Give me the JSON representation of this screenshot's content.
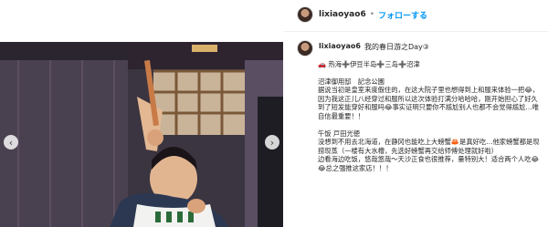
{
  "post": {
    "username": "lixiaoyao6",
    "follow_label": "フォローする",
    "separator": "•",
    "caption_title": "我的春日游之Day③",
    "route": "🚗 热海➕伊豆半岛➕三岛➕沼津",
    "section1_heading": "沼津御用邸　記念公園",
    "section1_body": "据说当初是皇室来度假住的，在这大院子里也想得到上和服来体验一把😂，因为我这正儿八经穿过和服所以这次体验打满分哈哈哈，刚开始担心了好久到了短发能穿好和服吗😂事实证明只要你不尴尬别人也都不会觉得尴尬…唯自信最重要！！",
    "section2_heading": "午饭 戸田光徳",
    "section2_body": "没想到不用去北海道，在静冈也能吃上大螃蟹🦀是真好吃…他家螃蟹都是现捞现蒸（一楼有大水槽，先选好螃蟹再交给师傅处理就好啦）",
    "section3_body": "边看海边吃饭，悠哉悠哉～天沙正食也很推荐，量特别大！适合两个人吃😂😂总之强推这家店！！！"
  },
  "carousel": {
    "prev_icon": "‹",
    "next_icon": "›"
  }
}
